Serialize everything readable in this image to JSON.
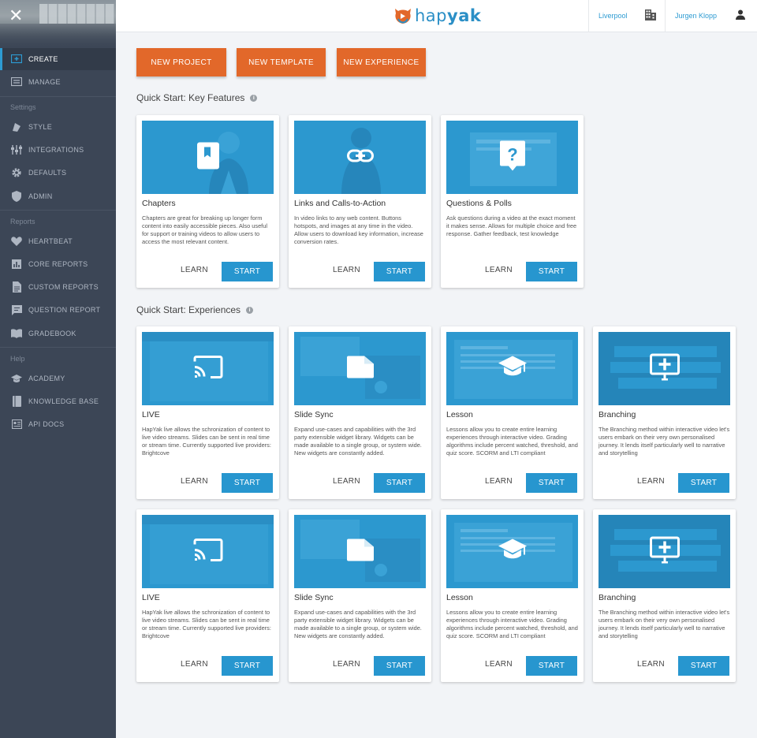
{
  "sidebar": {
    "close_icon": "close-icon",
    "items": [
      {
        "label": "CREATE",
        "icon": "create-icon",
        "active": true
      },
      {
        "label": "MANAGE",
        "icon": "manage-icon"
      },
      {
        "label": "STYLE",
        "icon": "style-icon"
      },
      {
        "label": "INTEGRATIONS",
        "icon": "integrations-icon"
      },
      {
        "label": "DEFAULTS",
        "icon": "gear-icon"
      },
      {
        "label": "ADMIN",
        "icon": "shield-icon"
      },
      {
        "label": "HEARTBEAT",
        "icon": "heart-icon"
      },
      {
        "label": "CORE REPORTS",
        "icon": "bar-chart-icon"
      },
      {
        "label": "CUSTOM REPORTS",
        "icon": "document-icon"
      },
      {
        "label": "QUESTION REPORT",
        "icon": "comment-icon"
      },
      {
        "label": "GRADEBOOK",
        "icon": "book-icon"
      },
      {
        "label": "ACADEMY",
        "icon": "graduation-cap-icon"
      },
      {
        "label": "KNOWLEDGE BASE",
        "icon": "knowledge-base-icon"
      },
      {
        "label": "API DOCS",
        "icon": "api-docs-icon"
      }
    ],
    "sections": {
      "settings": "Settings",
      "reports": "Reports",
      "help": "Help"
    }
  },
  "topbar": {
    "logo_text_light": "hap",
    "logo_text_bold": "yak",
    "location": "Liverpool",
    "user": "Jurgen Klopp"
  },
  "actions": {
    "new_project": "NEW PROJECT",
    "new_template": "NEW TEMPLATE",
    "new_experience": "NEW EXPERIENCE"
  },
  "key_features": {
    "title": "Quick Start: Key Features",
    "cards": [
      {
        "title": "Chapters",
        "desc": "Chapters are great for breaking up longer form content into easily accessible pieces. Also useful for support or training videos to allow users to access the most relevant content.",
        "icon": "bookmark-icon",
        "learn": "LEARN",
        "start": "START"
      },
      {
        "title": "Links and Calls-to-Action",
        "desc": "In video links to any web content. Buttons hotspots, and images at any time in the video. Allow users to download key information, increase conversion rates.",
        "icon": "link-icon",
        "learn": "LEARN",
        "start": "START"
      },
      {
        "title": "Questions & Polls",
        "desc": "Ask questions during a video at the exact moment it makes sense. Allows for multiple choice and free response. Gather feedback, test knowledge",
        "icon": "question-icon",
        "learn": "LEARN",
        "start": "START"
      }
    ]
  },
  "experiences": {
    "title": "Quick Start: Experiences",
    "cards": [
      {
        "title": "LIVE",
        "desc": "HapYak live allows the schronization of content to live video streams. Slides can be sent in real time or stream time. Currently supported live providers: Brightcove",
        "icon": "cast-icon",
        "learn": "LEARN",
        "start": "START"
      },
      {
        "title": "Slide Sync",
        "desc": "Expand use-cases and capabilities with the 3rd party extensible widget library. Widgets can be made available to a single group, or system wide. New widgets are constantly added.",
        "icon": "slide-icon",
        "learn": "LEARN",
        "start": "START"
      },
      {
        "title": "Lesson",
        "desc": "Lessons allow you to create entire learning experiences through interactive video. Grading algorithms include percent watched, threshold, and quiz score. SCORM and LTI compliant",
        "icon": "graduation-cap-icon",
        "learn": "LEARN",
        "start": "START"
      },
      {
        "title": "Branching",
        "desc": "The Branching method within interactive video let's users embark on their very own personalised journey. It lends itself particularly well to narrative and storytelling",
        "icon": "branching-icon",
        "learn": "LEARN",
        "start": "START"
      },
      {
        "title": "LIVE",
        "desc": "HapYak live allows the schronization of content to live video streams. Slides can be sent in real time or stream time. Currently supported live providers: Brightcove",
        "icon": "cast-icon",
        "learn": "LEARN",
        "start": "START"
      },
      {
        "title": "Slide Sync",
        "desc": "Expand use-cases and capabilities with the 3rd party extensible widget library. Widgets can be made available to a single group, or system wide. New widgets are constantly added.",
        "icon": "slide-icon",
        "learn": "LEARN",
        "start": "START"
      },
      {
        "title": "Lesson",
        "desc": "Lessons allow you to create entire learning experiences through interactive video. Grading algorithms include percent watched, threshold, and quiz score. SCORM and LTI compliant",
        "icon": "graduation-cap-icon",
        "learn": "LEARN",
        "start": "START"
      },
      {
        "title": "Branching",
        "desc": "The Branching method within interactive video let's users embark on their very own personalised journey. It lends itself particularly well to narrative and storytelling",
        "icon": "branching-icon",
        "learn": "LEARN",
        "start": "START"
      }
    ]
  },
  "colors": {
    "sidebar": "#3c4656",
    "accent_orange": "#e2682a",
    "accent_blue": "#2796cf",
    "thumb_blue": "#2c98cf"
  }
}
